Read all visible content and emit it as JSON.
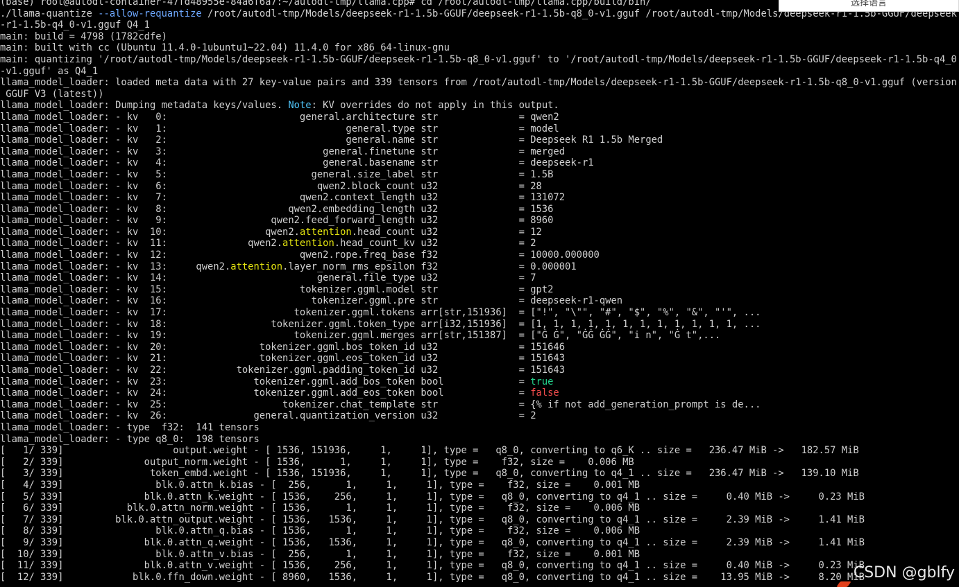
{
  "terminal": {
    "lines": [
      [
        {
          "t": "(base) root@autodl-container-47fd48955e-84a6f6a7:~/autodl-tmp/llama.cpp# cd /root/autodl-tmp/llama.cpp/build/bin/"
        }
      ],
      [
        {
          "t": "./llama-quantize "
        },
        {
          "t": "--allow-requantize",
          "c": "flag"
        },
        {
          "t": " /root/autodl-tmp/Models/deepseek-r1-1.5b-GGUF/deepseek-r1-1.5b-q8_0-v1.gguf /root/autodl-tmp/Models/deepseek-r1-1.5b-GGUF/deepseek"
        }
      ],
      [
        {
          "t": "-r1-1.5b-q4_0-v1.gguf Q4_1"
        }
      ],
      [
        {
          "t": "main: build = 4798 (1782cdfe)"
        }
      ],
      [
        {
          "t": "main: built with cc (Ubuntu 11.4.0-1ubuntu1~22.04) 11.4.0 for x86_64-linux-gnu"
        }
      ],
      [
        {
          "t": "main: quantizing '/root/autodl-tmp/Models/deepseek-r1-1.5b-GGUF/deepseek-r1-1.5b-q8_0-v1.gguf' to '/root/autodl-tmp/Models/deepseek-r1-1.5b-GGUF/deepseek-r1-1.5b-q4_0"
        }
      ],
      [
        {
          "t": "-v1.gguf' as Q4_1"
        }
      ],
      [
        {
          "t": "llama_model_loader: loaded meta data with 27 key-value pairs and 339 tensors from /root/autodl-tmp/Models/deepseek-r1-1.5b-GGUF/deepseek-r1-1.5b-q8_0-v1.gguf (version"
        }
      ],
      [
        {
          "t": " GGUF V3 (latest))"
        }
      ],
      [
        {
          "t": "llama_model_loader: Dumping metadata keys/values. "
        },
        {
          "t": "Note",
          "c": "note"
        },
        {
          "t": ": KV overrides do not apply in this output."
        }
      ],
      [
        {
          "t": "llama_model_loader: - kv   0:                       general.architecture str              = qwen2"
        }
      ],
      [
        {
          "t": "llama_model_loader: - kv   1:                               general.type str              = model"
        }
      ],
      [
        {
          "t": "llama_model_loader: - kv   2:                               general.name str              = Deepseek R1 1.5b Merged"
        }
      ],
      [
        {
          "t": "llama_model_loader: - kv   3:                           general.finetune str              = merged"
        }
      ],
      [
        {
          "t": "llama_model_loader: - kv   4:                           general.basename str              = deepseek-r1"
        }
      ],
      [
        {
          "t": "llama_model_loader: - kv   5:                         general.size_label str              = 1.5B"
        }
      ],
      [
        {
          "t": "llama_model_loader: - kv   6:                          qwen2.block_count u32              = 28"
        }
      ],
      [
        {
          "t": "llama_model_loader: - kv   7:                       qwen2.context_length u32              = 131072"
        }
      ],
      [
        {
          "t": "llama_model_loader: - kv   8:                     qwen2.embedding_length u32              = 1536"
        }
      ],
      [
        {
          "t": "llama_model_loader: - kv   9:                  qwen2.feed_forward_length u32              = 8960"
        }
      ],
      [
        {
          "t": "llama_model_loader: - kv  10:                 qwen2."
        },
        {
          "t": "attention",
          "c": "yellow"
        },
        {
          "t": ".head_count u32              = 12"
        }
      ],
      [
        {
          "t": "llama_model_loader: - kv  11:              qwen2."
        },
        {
          "t": "attention",
          "c": "yellow"
        },
        {
          "t": ".head_count_kv u32              = 2"
        }
      ],
      [
        {
          "t": "llama_model_loader: - kv  12:                       qwen2.rope.freq_base f32              = 10000.000000"
        }
      ],
      [
        {
          "t": "llama_model_loader: - kv  13:     qwen2."
        },
        {
          "t": "attention",
          "c": "yellow"
        },
        {
          "t": ".layer_norm_rms_epsilon f32              = 0.000001"
        }
      ],
      [
        {
          "t": "llama_model_loader: - kv  14:                          general.file_type u32              = 7"
        }
      ],
      [
        {
          "t": "llama_model_loader: - kv  15:                       tokenizer.ggml.model str              = gpt2"
        }
      ],
      [
        {
          "t": "llama_model_loader: - kv  16:                         tokenizer.ggml.pre str              = deepseek-r1-qwen"
        }
      ],
      [
        {
          "t": "llama_model_loader: - kv  17:                      tokenizer.ggml.tokens arr[str,151936]  = [\"!\", \"\\\"\", \"#\", \"$\", \"%\", \"&\", \"'\", ..."
        }
      ],
      [
        {
          "t": "llama_model_loader: - kv  18:                  tokenizer.ggml.token_type arr[i32,151936]  = [1, 1, 1, 1, 1, 1, 1, 1, 1, 1, 1, 1, ..."
        }
      ],
      [
        {
          "t": "llama_model_loader: - kv  19:                      tokenizer.ggml.merges arr[str,151387]  = [\"Ġ Ġ\", \"ĠĠ ĠĠ\", \"i n\", \"Ġ t\",..."
        }
      ],
      [
        {
          "t": "llama_model_loader: - kv  20:                tokenizer.ggml.bos_token_id u32              = 151646"
        }
      ],
      [
        {
          "t": "llama_model_loader: - kv  21:                tokenizer.ggml.eos_token_id u32              = 151643"
        }
      ],
      [
        {
          "t": "llama_model_loader: - kv  22:            tokenizer.ggml.padding_token_id u32              = 151643"
        }
      ],
      [
        {
          "t": "llama_model_loader: - kv  23:               tokenizer.ggml.add_bos_token bool             = "
        },
        {
          "t": "true",
          "c": "true"
        }
      ],
      [
        {
          "t": "llama_model_loader: - kv  24:               tokenizer.ggml.add_eos_token bool             = "
        },
        {
          "t": "false",
          "c": "false"
        }
      ],
      [
        {
          "t": "llama_model_loader: - kv  25:                    tokenizer.chat_template str              = {% if not add_generation_prompt is de..."
        }
      ],
      [
        {
          "t": "llama_model_loader: - kv  26:               general.quantization_version u32              = 2"
        }
      ],
      [
        {
          "t": "llama_model_loader: - type  f32:  141 tensors"
        }
      ],
      [
        {
          "t": "llama_model_loader: - type q8_0:  198 tensors"
        }
      ],
      [
        {
          "t": "[   1/ 339]                   output.weight - [ 1536, 151936,     1,     1], type =   q8_0, converting to q6_K .. size =   236.47 MiB ->   182.57 MiB"
        }
      ],
      [
        {
          "t": "[   2/ 339]              output_norm.weight - [ 1536,      1,     1,     1], type =    f32, size =    0.006 MB"
        }
      ],
      [
        {
          "t": "[   3/ 339]               token_embd.weight - [ 1536, 151936,     1,     1], type =   q8_0, converting to q4_1 .. size =   236.47 MiB ->   139.10 MiB"
        }
      ],
      [
        {
          "t": "[   4/ 339]                blk.0.attn_k.bias - [  256,      1,     1,     1], type =    f32, size =    0.001 MB"
        }
      ],
      [
        {
          "t": "[   5/ 339]              blk.0.attn_k.weight - [ 1536,    256,     1,     1], type =   q8_0, converting to q4_1 .. size =     0.40 MiB ->     0.23 MiB"
        }
      ],
      [
        {
          "t": "[   6/ 339]           blk.0.attn_norm.weight - [ 1536,      1,     1,     1], type =    f32, size =    0.006 MB"
        }
      ],
      [
        {
          "t": "[   7/ 339]         blk.0.attn_output.weight - [ 1536,   1536,     1,     1], type =   q8_0, converting to q4_1 .. size =     2.39 MiB ->     1.41 MiB"
        }
      ],
      [
        {
          "t": "[   8/ 339]                blk.0.attn_q.bias - [ 1536,      1,     1,     1], type =    f32, size =    0.006 MB"
        }
      ],
      [
        {
          "t": "[   9/ 339]              blk.0.attn_q.weight - [ 1536,   1536,     1,     1], type =   q8_0, converting to q4_1 .. size =     2.39 MiB ->     1.41 MiB"
        }
      ],
      [
        {
          "t": "[  10/ 339]                blk.0.attn_v.bias - [  256,      1,     1,     1], type =    f32, size =    0.001 MB"
        }
      ],
      [
        {
          "t": "[  11/ 339]              blk.0.attn_v.weight - [ 1536,    256,     1,     1], type =   q8_0, converting to q4_1 .. size =     0.40 MiB ->     0.23 MiB"
        }
      ],
      [
        {
          "t": "[  12/ 339]            blk.0.ffn_down.weight - [ 8960,   1536,     1,     1], type =   q8_0, converting to q4_1 .. size =    13.95 MiB ->     8.20 MiB"
        }
      ]
    ]
  },
  "ime_popup": {
    "label": "选择语言"
  },
  "watermark": {
    "text": "CSDN @gblfy"
  }
}
